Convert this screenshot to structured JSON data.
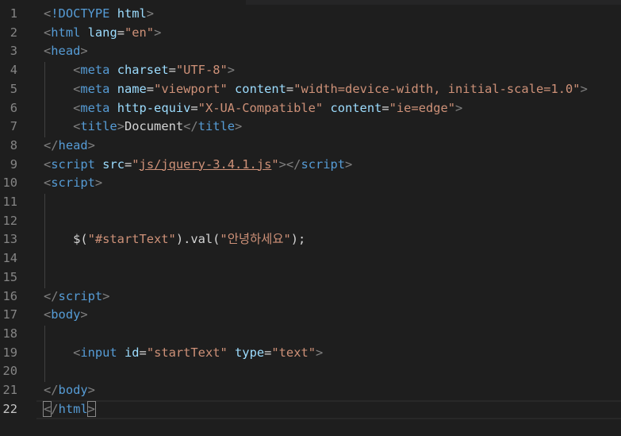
{
  "editor": {
    "active_line": 22,
    "lines": [
      {
        "n": "1",
        "tokens": [
          [
            "t-punc",
            "<"
          ],
          [
            "t-doctype",
            "!DOCTYPE"
          ],
          [
            "t-text",
            " "
          ],
          [
            "t-attr",
            "html"
          ],
          [
            "t-punc",
            ">"
          ]
        ]
      },
      {
        "n": "2",
        "tokens": [
          [
            "t-punc",
            "<"
          ],
          [
            "t-tag",
            "html"
          ],
          [
            "t-text",
            " "
          ],
          [
            "t-attr",
            "lang"
          ],
          [
            "t-text",
            "="
          ],
          [
            "t-str",
            "\"en\""
          ],
          [
            "t-punc",
            ">"
          ]
        ]
      },
      {
        "n": "3",
        "tokens": [
          [
            "t-punc",
            "<"
          ],
          [
            "t-tag",
            "head"
          ],
          [
            "t-punc",
            ">"
          ]
        ]
      },
      {
        "n": "4",
        "tokens": [
          [
            "t-text",
            "    "
          ],
          [
            "t-punc",
            "<"
          ],
          [
            "t-tag",
            "meta"
          ],
          [
            "t-text",
            " "
          ],
          [
            "t-attr",
            "charset"
          ],
          [
            "t-text",
            "="
          ],
          [
            "t-str",
            "\"UTF-8\""
          ],
          [
            "t-punc",
            ">"
          ]
        ]
      },
      {
        "n": "5",
        "tokens": [
          [
            "t-text",
            "    "
          ],
          [
            "t-punc",
            "<"
          ],
          [
            "t-tag",
            "meta"
          ],
          [
            "t-text",
            " "
          ],
          [
            "t-attr",
            "name"
          ],
          [
            "t-text",
            "="
          ],
          [
            "t-str",
            "\"viewport\""
          ],
          [
            "t-text",
            " "
          ],
          [
            "t-attr",
            "content"
          ],
          [
            "t-text",
            "="
          ],
          [
            "t-str",
            "\"width=device-width, initial-scale=1.0\""
          ],
          [
            "t-punc",
            ">"
          ]
        ]
      },
      {
        "n": "6",
        "tokens": [
          [
            "t-text",
            "    "
          ],
          [
            "t-punc",
            "<"
          ],
          [
            "t-tag",
            "meta"
          ],
          [
            "t-text",
            " "
          ],
          [
            "t-attr",
            "http-equiv"
          ],
          [
            "t-text",
            "="
          ],
          [
            "t-str",
            "\"X-UA-Compatible\""
          ],
          [
            "t-text",
            " "
          ],
          [
            "t-attr",
            "content"
          ],
          [
            "t-text",
            "="
          ],
          [
            "t-str",
            "\"ie=edge\""
          ],
          [
            "t-punc",
            ">"
          ]
        ]
      },
      {
        "n": "7",
        "tokens": [
          [
            "t-text",
            "    "
          ],
          [
            "t-punc",
            "<"
          ],
          [
            "t-tag",
            "title"
          ],
          [
            "t-punc",
            ">"
          ],
          [
            "t-text",
            "Document"
          ],
          [
            "t-punc",
            "</"
          ],
          [
            "t-tag",
            "title"
          ],
          [
            "t-punc",
            ">"
          ]
        ]
      },
      {
        "n": "8",
        "tokens": [
          [
            "t-punc",
            "</"
          ],
          [
            "t-tag",
            "head"
          ],
          [
            "t-punc",
            ">"
          ]
        ]
      },
      {
        "n": "9",
        "tokens": [
          [
            "t-punc",
            "<"
          ],
          [
            "t-tag",
            "script"
          ],
          [
            "t-text",
            " "
          ],
          [
            "t-attr",
            "src"
          ],
          [
            "t-text",
            "="
          ],
          [
            "t-str",
            "\""
          ],
          [
            "t-link",
            "js/jquery-3.4.1.js"
          ],
          [
            "t-str",
            "\""
          ],
          [
            "t-punc",
            "></"
          ],
          [
            "t-tag",
            "script"
          ],
          [
            "t-punc",
            ">"
          ]
        ]
      },
      {
        "n": "10",
        "tokens": [
          [
            "t-punc",
            "<"
          ],
          [
            "t-tag",
            "script"
          ],
          [
            "t-punc",
            ">"
          ]
        ]
      },
      {
        "n": "11",
        "tokens": []
      },
      {
        "n": "12",
        "tokens": []
      },
      {
        "n": "13",
        "tokens": [
          [
            "t-text",
            "    $("
          ],
          [
            "t-str",
            "\"#startText\""
          ],
          [
            "t-text",
            ").val("
          ],
          [
            "t-str",
            "\"안녕하세요\""
          ],
          [
            "t-text",
            ");"
          ]
        ]
      },
      {
        "n": "14",
        "tokens": []
      },
      {
        "n": "15",
        "tokens": []
      },
      {
        "n": "16",
        "tokens": [
          [
            "t-punc",
            "</"
          ],
          [
            "t-tag",
            "script"
          ],
          [
            "t-punc",
            ">"
          ]
        ]
      },
      {
        "n": "17",
        "tokens": [
          [
            "t-punc",
            "<"
          ],
          [
            "t-tag",
            "body"
          ],
          [
            "t-punc",
            ">"
          ]
        ]
      },
      {
        "n": "18",
        "tokens": []
      },
      {
        "n": "19",
        "tokens": [
          [
            "t-text",
            "    "
          ],
          [
            "t-punc",
            "<"
          ],
          [
            "t-tag",
            "input"
          ],
          [
            "t-text",
            " "
          ],
          [
            "t-attr",
            "id"
          ],
          [
            "t-text",
            "="
          ],
          [
            "t-str",
            "\"startText\""
          ],
          [
            "t-text",
            " "
          ],
          [
            "t-attr",
            "type"
          ],
          [
            "t-text",
            "="
          ],
          [
            "t-str",
            "\"text\""
          ],
          [
            "t-punc",
            ">"
          ]
        ]
      },
      {
        "n": "20",
        "tokens": []
      },
      {
        "n": "21",
        "tokens": [
          [
            "t-punc",
            "</"
          ],
          [
            "t-tag",
            "body"
          ],
          [
            "t-punc",
            ">"
          ]
        ]
      },
      {
        "n": "22",
        "tokens": [
          [
            "t-punc bracket-match",
            "<"
          ],
          [
            "t-punc",
            "/"
          ],
          [
            "t-tag",
            "html"
          ],
          [
            "t-punc bracket-match",
            ">"
          ]
        ]
      }
    ]
  }
}
